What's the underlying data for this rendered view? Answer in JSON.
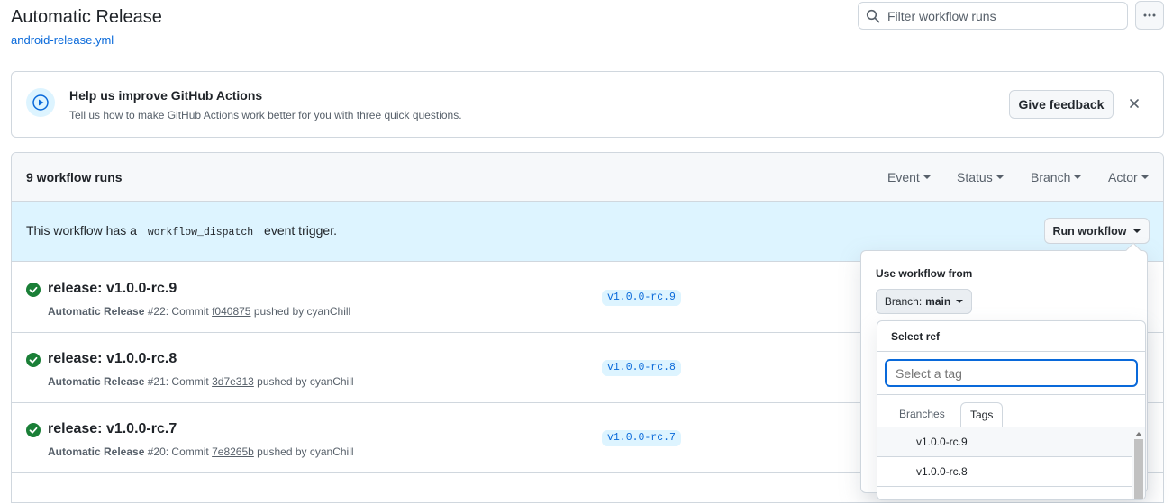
{
  "header": {
    "title": "Automatic Release",
    "file_link": "android-release.yml",
    "filter_placeholder": "Filter workflow runs"
  },
  "banner": {
    "title": "Help us improve GitHub Actions",
    "description": "Tell us how to make GitHub Actions work better for you with three quick questions.",
    "feedback_button": "Give feedback"
  },
  "runs_header": {
    "count": "9 workflow runs",
    "filters": [
      "Event",
      "Status",
      "Branch",
      "Actor"
    ]
  },
  "dispatch": {
    "prefix": "This workflow has a",
    "code": "workflow_dispatch",
    "suffix": "event trigger.",
    "run_button": "Run workflow"
  },
  "runs": [
    {
      "title": "release: v1.0.0-rc.9",
      "workflow": "Automatic Release",
      "number": "#22",
      "commit_prefix": ": Commit",
      "sha": "f040875",
      "pusher": "pushed by cyanChill",
      "tag": "v1.0.0-rc.9"
    },
    {
      "title": "release: v1.0.0-rc.8",
      "workflow": "Automatic Release",
      "number": "#21",
      "commit_prefix": ": Commit",
      "sha": "3d7e313",
      "pusher": "pushed by cyanChill",
      "tag": "v1.0.0-rc.8"
    },
    {
      "title": "release: v1.0.0-rc.7",
      "workflow": "Automatic Release",
      "number": "#20",
      "commit_prefix": ": Commit",
      "sha": "7e8265b",
      "pusher": "pushed by cyanChill",
      "tag": "v1.0.0-rc.7"
    }
  ],
  "run_workflow_popover": {
    "label": "Use workflow from",
    "branch_prefix": "Branch:",
    "branch_value": "main",
    "select_ref_title": "Select ref",
    "search_placeholder": "Select a tag",
    "tabs": [
      "Branches",
      "Tags"
    ],
    "active_tab": "Tags",
    "items": [
      "v1.0.0-rc.9",
      "v1.0.0-rc.8"
    ]
  },
  "colors": {
    "link": "#0969da",
    "success": "#1a7f37",
    "dispatch_bg": "#ddf4ff",
    "border": "#d0d7de"
  },
  "icons": {
    "search": "search-icon",
    "more": "kebab-horizontal-icon",
    "play": "play-icon",
    "close": "close-icon",
    "success": "check-circle-fill-icon"
  }
}
